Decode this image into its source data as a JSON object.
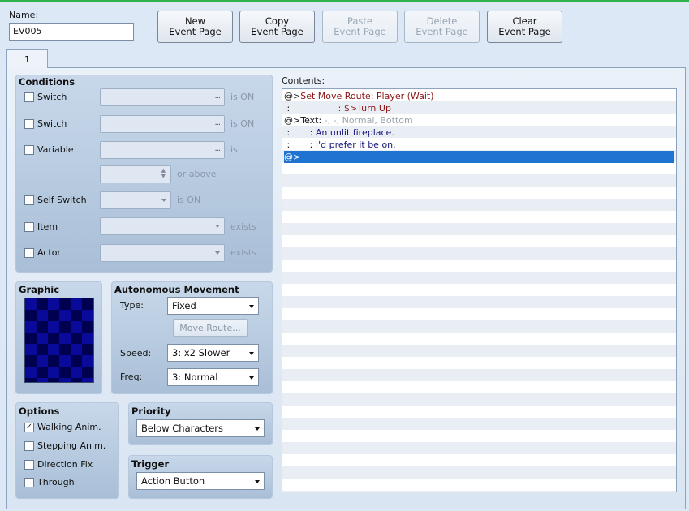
{
  "name": {
    "label": "Name:",
    "value": "EV005"
  },
  "toolbar": {
    "new": "New\nEvent Page",
    "copy": "Copy\nEvent Page",
    "paste": "Paste\nEvent Page",
    "delete": "Delete\nEvent Page",
    "clear": "Clear\nEvent Page"
  },
  "tabs": [
    "1"
  ],
  "conditions": {
    "title": "Conditions",
    "switch1": {
      "label": "Switch",
      "suffix": "is ON"
    },
    "switch2": {
      "label": "Switch",
      "suffix": "is ON"
    },
    "variable": {
      "label": "Variable",
      "suffix": "is",
      "above": "or above"
    },
    "self_switch": {
      "label": "Self Switch",
      "suffix": "is ON"
    },
    "item": {
      "label": "Item",
      "suffix": "exists"
    },
    "actor": {
      "label": "Actor",
      "suffix": "exists"
    },
    "ellipsis": "..."
  },
  "graphic": {
    "title": "Graphic"
  },
  "autonomous": {
    "title": "Autonomous Movement",
    "type_label": "Type:",
    "type_value": "Fixed",
    "move_route": "Move Route...",
    "speed_label": "Speed:",
    "speed_value": "3: x2 Slower",
    "freq_label": "Freq:",
    "freq_value": "3: Normal"
  },
  "options": {
    "title": "Options",
    "walking": {
      "label": "Walking Anim.",
      "checked": "✓"
    },
    "stepping": {
      "label": "Stepping Anim."
    },
    "direction": {
      "label": "Direction Fix"
    },
    "through": {
      "label": "Through"
    }
  },
  "priority": {
    "title": "Priority",
    "value": "Below Characters"
  },
  "trigger": {
    "title": "Trigger",
    "value": "Action Button"
  },
  "contents": {
    "label": "Contents:",
    "lines": [
      {
        "prefix": "@>",
        "text": "Set Move Route: Player (Wait)"
      },
      {
        "prefix": " :",
        "pad": "                 ",
        "text": ": $>Turn Up"
      },
      {
        "prefix": "@>",
        "text": "Text: ",
        "extra": "-, -, Normal, Bottom"
      },
      {
        "prefix": " :",
        "pad": "       : ",
        "text": "An unlit fireplace."
      },
      {
        "prefix": " :",
        "pad": "       : ",
        "text": "I'd prefer it be on."
      },
      {
        "prefix": "@>",
        "text": ""
      }
    ]
  }
}
